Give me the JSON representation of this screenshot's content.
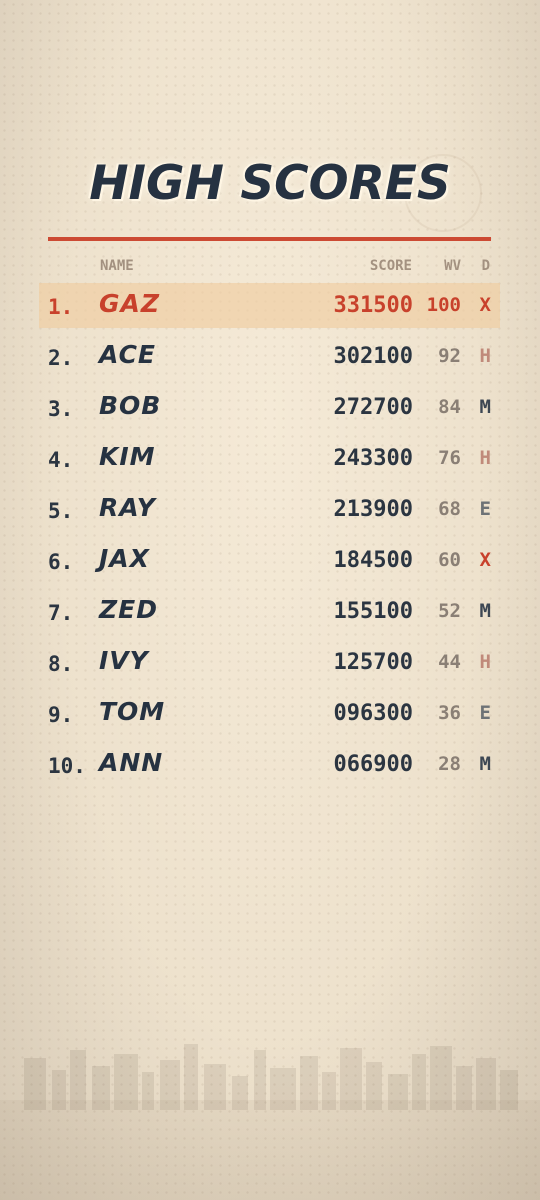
{
  "screen": {
    "title": "HIGH SCORES",
    "accent_color": "#cc4a33",
    "ink_color": "#263241"
  },
  "table": {
    "headers": {
      "name": "NAME",
      "score": "SCORE",
      "wave": "WV",
      "difficulty": "D"
    },
    "rows": [
      {
        "rank": "1.",
        "name": "GAZ",
        "score": "331500",
        "wave": "100",
        "difficulty": "X"
      },
      {
        "rank": "2.",
        "name": "ACE",
        "score": "302100",
        "wave": "92",
        "difficulty": "H"
      },
      {
        "rank": "3.",
        "name": "BOB",
        "score": "272700",
        "wave": "84",
        "difficulty": "M"
      },
      {
        "rank": "4.",
        "name": "KIM",
        "score": "243300",
        "wave": "76",
        "difficulty": "H"
      },
      {
        "rank": "5.",
        "name": "RAY",
        "score": "213900",
        "wave": "68",
        "difficulty": "E"
      },
      {
        "rank": "6.",
        "name": "JAX",
        "score": "184500",
        "wave": "60",
        "difficulty": "X"
      },
      {
        "rank": "7.",
        "name": "ZED",
        "score": "155100",
        "wave": "52",
        "difficulty": "M"
      },
      {
        "rank": "8.",
        "name": "IVY",
        "score": "125700",
        "wave": "44",
        "difficulty": "H"
      },
      {
        "rank": "9.",
        "name": "TOM",
        "score": "096300",
        "wave": "36",
        "difficulty": "E"
      },
      {
        "rank": "10.",
        "name": "ANN",
        "score": "066900",
        "wave": "28",
        "difficulty": "M"
      }
    ]
  }
}
